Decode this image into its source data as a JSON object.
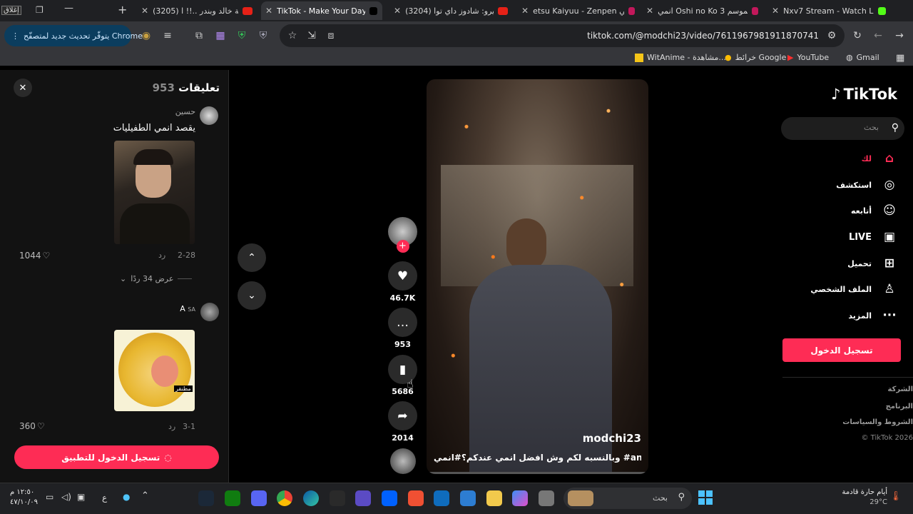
{
  "tabs": [
    {
      "title": "Nxv7 Stream - Watch Live"
    },
    {
      "title": "انمي Oshi no Ko الموسم 3"
    },
    {
      "title": "etsu Kaiyuu - Zenpen انمي"
    },
    {
      "title": "(3204) سكيرو: شادوز داي توا"
    },
    {
      "title": "TikTok - Make Your Day"
    },
    {
      "title": "(3205) قصة خالد وبندر ..!! ا"
    }
  ],
  "window": {
    "close_label": "إغلاق"
  },
  "address": {
    "url": "tiktok.com/@modchi23/video/7611967981911870741"
  },
  "update_button": {
    "label": "يتوفّر تحديث جديد لمتصفّح Chrome"
  },
  "bookmarks": [
    {
      "label": "Gmail"
    },
    {
      "label": "YouTube"
    },
    {
      "label": "خرائط Google"
    },
    {
      "label": "WitAnime - مشاهدة..."
    }
  ],
  "tiktok": {
    "logo": "TikTok",
    "search_placeholder": "بحث",
    "nav": [
      {
        "label": "لك",
        "icon": "home-icon"
      },
      {
        "label": "استكشف",
        "icon": "compass-icon"
      },
      {
        "label": "أتابعه",
        "icon": "user-plus-icon"
      },
      {
        "label": "LIVE",
        "icon": "live-icon"
      },
      {
        "label": "تحميل",
        "icon": "plus-square-icon"
      },
      {
        "label": "الملف الشخصي",
        "icon": "user-icon"
      },
      {
        "label": "المزيد",
        "icon": "more-icon"
      }
    ],
    "login_label": "تسجيل الدخول",
    "footer": [
      "الشركة",
      "البرنامج",
      "الشروط والسياسات",
      "© TikTok 2026"
    ]
  },
  "video": {
    "username": "modchi23",
    "caption": "وبالنسبه لكم وش افضل انمي عندكم؟#انمي #anime"
  },
  "actions": {
    "likes": "46.7K",
    "comments": "953",
    "saves": "5686",
    "shares": "2014"
  },
  "comments_panel": {
    "title": "تعليقات",
    "count": "953",
    "items": [
      {
        "user": "حسين",
        "text": "يقصد انمي الطفيليات",
        "date": "2-28",
        "reply": "رد",
        "likes": "1044"
      },
      {
        "user": "A",
        "badge": "SA",
        "sticker": "مطنقر",
        "date": "3-1",
        "reply": "رد",
        "likes": "360"
      }
    ],
    "view_replies": "عرض 34 ردًا",
    "login_app": "تسجيل الدخول للتطبيق"
  },
  "taskbar": {
    "search": "بحث",
    "weather": "أيام حارة قادمة",
    "temp": "29°C",
    "time": "١٢:٥٠ م",
    "date": "٤٧/١٠/٠٩",
    "lang": "ع"
  }
}
